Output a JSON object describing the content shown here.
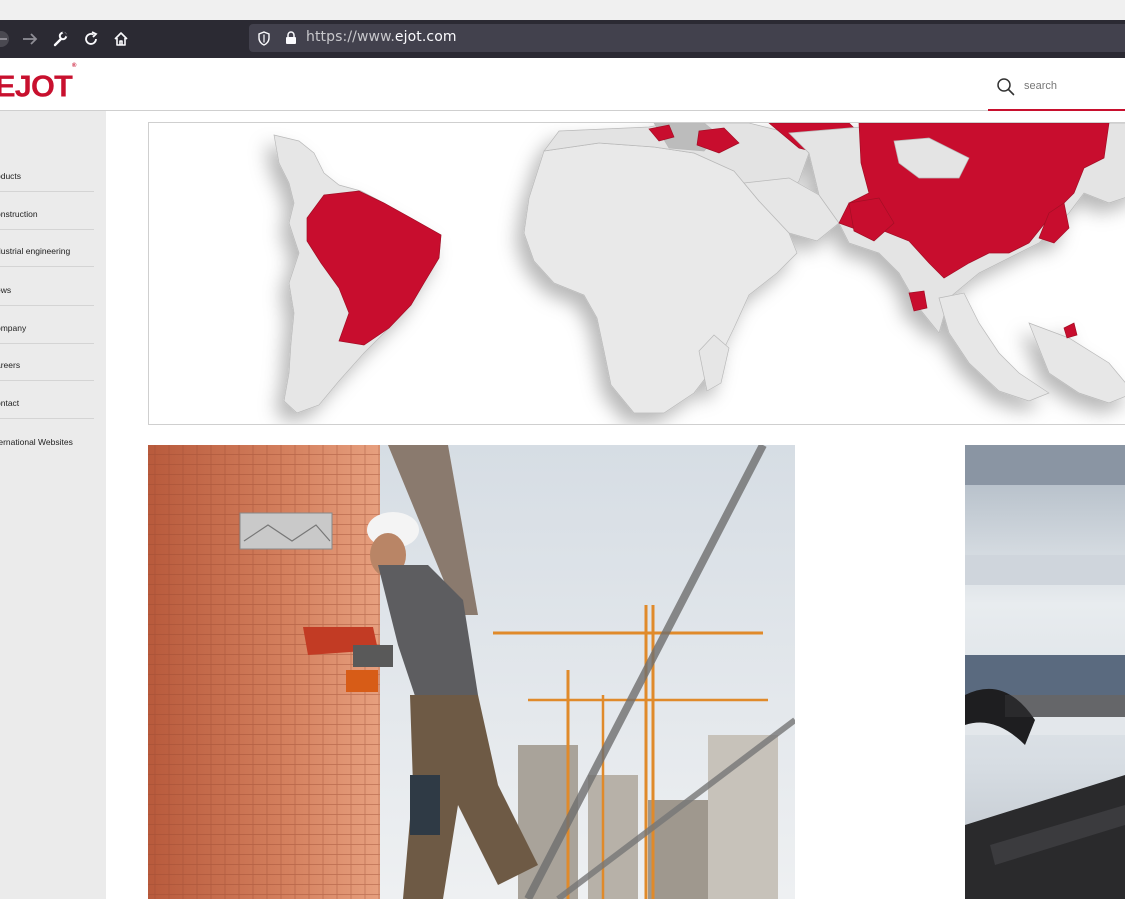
{
  "browser": {
    "url_prefix": "https://www.",
    "url_domain": "ejot.com",
    "icons": [
      "back-icon",
      "forward-icon",
      "wrench-icon",
      "reload-icon",
      "home-icon",
      "shield-icon",
      "lock-icon"
    ]
  },
  "header": {
    "logo": "EJOT",
    "logo_mark": "®",
    "search_placeholder": "search"
  },
  "sidebar": {
    "items": [
      {
        "label": "oducts"
      },
      {
        "label": "onstruction"
      },
      {
        "label": "dustrial engineering"
      },
      {
        "label": "ews"
      },
      {
        "label": "ompany"
      },
      {
        "label": "areers"
      },
      {
        "label": "ontact"
      },
      {
        "label": "ternational Websites"
      }
    ]
  },
  "colors": {
    "brand": "#c8102e",
    "toolbar": "#2b2a33",
    "urlbar": "#42414d",
    "sidebar": "#ebebeb"
  }
}
